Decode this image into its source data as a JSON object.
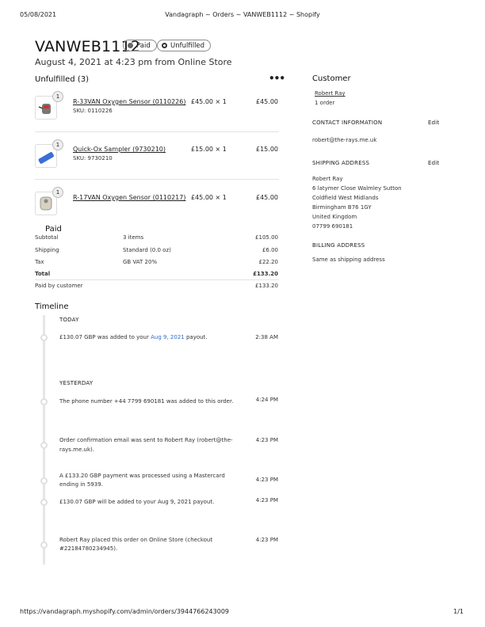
{
  "print_header": {
    "date": "05/08/2021",
    "title": "Vandagraph ~ Orders ~ VANWEB1112 ~ Shopify",
    "url": "https://vandagraph.myshopify.com/admin/orders/3944766243009",
    "page": "1/1"
  },
  "order": {
    "name": "VANWEB1112",
    "paid_badge": "Paid",
    "fulfillment_badge": "Unfulfilled",
    "subtitle": "August 4, 2021 at 4:23 pm from Online Store"
  },
  "unfulfilled": {
    "heading": "Unfulfilled (3)",
    "more_icon": "ellipsis-icon",
    "items": [
      {
        "qty": "1",
        "name": "R-33VAN Oxygen Sensor (0110226)",
        "sku": "SKU: 0110226",
        "price": "£45.00 × 1",
        "total": "£45.00"
      },
      {
        "qty": "1",
        "name": "Quick-Ox Sampler (9730210)",
        "sku": "SKU: 9730210",
        "price": "£15.00 × 1",
        "total": "£15.00"
      },
      {
        "qty": "1",
        "name": "R-17VAN Oxygen Sensor (0110217)",
        "sku": "",
        "price": "£45.00 × 1",
        "total": "£45.00"
      }
    ]
  },
  "payment": {
    "heading": "Paid",
    "rows": [
      {
        "label": "Subtotal",
        "detail": "3 items",
        "amount": "£105.00"
      },
      {
        "label": "Shipping",
        "detail": "Standard (0.0 oz)",
        "amount": "£6.00"
      },
      {
        "label": "Tax",
        "detail": "GB VAT 20%",
        "amount": "£22.20"
      }
    ],
    "total_label": "Total",
    "total_amount": "£133.20",
    "paid_label": "Paid by customer",
    "paid_amount": "£133.20"
  },
  "timeline": {
    "heading": "Timeline",
    "today_label": "TODAY",
    "yesterday_label": "YESTERDAY",
    "today_event": {
      "before": "£130.07 GBP was added to your ",
      "link": "Aug 9, 2021",
      "after": " payout.",
      "time": "2:38 AM"
    },
    "events": [
      {
        "line1": "The phone number +44 7799 690181 was added to this order.",
        "line2": "",
        "time": "4:24 PM"
      },
      {
        "line1": "Order confirmation email was sent to Robert Ray (robert@the-",
        "line2": "rays.me.uk).",
        "time": "4:23 PM"
      },
      {
        "line1": "A £133.20 GBP payment was processed using a Mastercard",
        "line2": "ending in 5939.",
        "time": "4:23 PM"
      },
      {
        "line1": "£130.07 GBP will be added to your Aug 9, 2021 payout.",
        "line2": "",
        "time": "4:23 PM"
      },
      {
        "line1": "Robert Ray placed this order on Online Store (checkout",
        "line2": "#22184780234945).",
        "time": "4:23 PM"
      }
    ]
  },
  "customer": {
    "heading": "Customer",
    "name": "Robert Ray",
    "orders": "1 order",
    "contact_heading": "CONTACT INFORMATION",
    "edit": "Edit",
    "email": "robert@the-rays.me.uk",
    "shipping_heading": "SHIPPING ADDRESS",
    "address": [
      "Robert Ray",
      "6 latymer Close Walmley Sutton",
      "Coldfield West Midlands",
      "Birmingham B76 1GY",
      "United Kingdom",
      "07799 690181"
    ],
    "billing_heading": "BILLING ADDRESS",
    "billing": "Same as shipping address"
  }
}
